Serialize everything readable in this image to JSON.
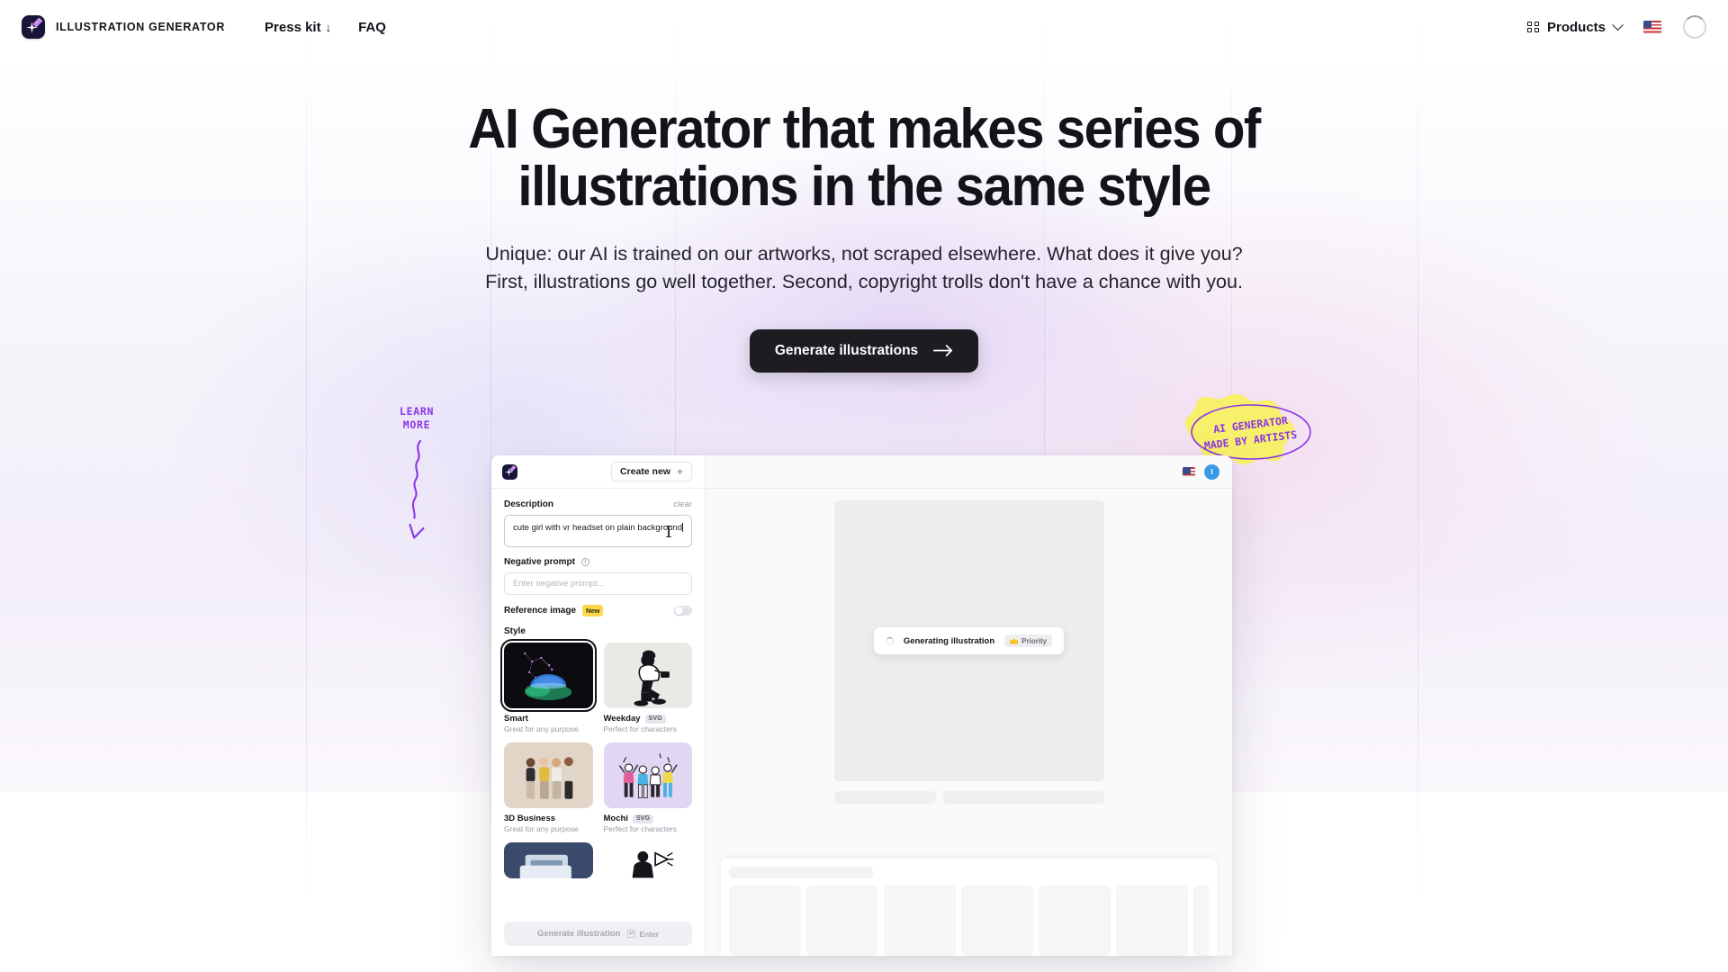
{
  "header": {
    "brand_name": "ILLUSTRATION GENERATOR",
    "logo_icon": "sparkle-brush-logo-icon",
    "nav": [
      {
        "label": "Press kit",
        "suffix": "↓"
      },
      {
        "label": "FAQ",
        "suffix": ""
      }
    ],
    "products_label": "Products",
    "products_icon": "grid-icon",
    "chevron_icon": "chevron-down-icon",
    "flag_icon": "us-flag-icon",
    "avatar_icon": "loading-ring-icon"
  },
  "hero": {
    "title_line1": "AI Generator that makes series of",
    "title_line2": "illustrations in the same style",
    "subtitle": "Unique: our AI is trained on our artworks, not scraped elsewhere. What does it give you? First, illustrations go well together. Second, copyright trolls don't have a chance with you.",
    "cta_label": "Generate illustrations",
    "cta_icon": "arrow-right-icon"
  },
  "decor": {
    "learn_more_line1": "LEARN",
    "learn_more_line2": "MORE",
    "learn_more_arrow_icon": "squiggly-arrow-down-icon",
    "learn_more_color": "#8b35e8",
    "sticker_line1": "AI GENERATOR",
    "sticker_line2": "MADE BY ARTISTS",
    "sticker_fill": "#f6f06a",
    "sticker_stroke": "#8b35e8"
  },
  "app": {
    "topbar": {
      "logo_icon": "sparkle-brush-logo-icon",
      "create_new_label": "Create new",
      "create_new_icon": "plus-icon",
      "flag_icon": "us-flag-icon",
      "avatar_initial": "I",
      "avatar_color": "#389ae6"
    },
    "sidebar": {
      "description_label": "Description",
      "clear_label": "clear",
      "description_value": "cute girl with vr headset on plain background",
      "cursor_icon": "i-beam-cursor-icon",
      "negative_prompt_label": "Negative prompt",
      "negative_prompt_info_icon": "info-circle-icon",
      "negative_prompt_placeholder": "Enter negative prompt...",
      "reference_image_label": "Reference image",
      "reference_image_badge": "New",
      "reference_image_toggle": "off",
      "style_label": "Style",
      "styles": [
        {
          "name": "Smart",
          "tag": "",
          "sub": "Great for any purpose",
          "selected": true
        },
        {
          "name": "Weekday",
          "tag": "SVG",
          "sub": "Perfect for characters",
          "selected": false
        },
        {
          "name": "3D Business",
          "tag": "",
          "sub": "Great for any purpose",
          "selected": false
        },
        {
          "name": "Mochi",
          "tag": "SVG",
          "sub": "Perfect for characters",
          "selected": false
        }
      ],
      "generate_label": "Generate illustration",
      "generate_key_hint": "Enter",
      "generate_key_icon": "enter-key-icon",
      "generate_disabled": true
    },
    "canvas": {
      "status_text": "Generating illustration",
      "status_spinner_icon": "spinner-icon",
      "priority_label": "Priority",
      "priority_icon": "crown-icon"
    }
  }
}
